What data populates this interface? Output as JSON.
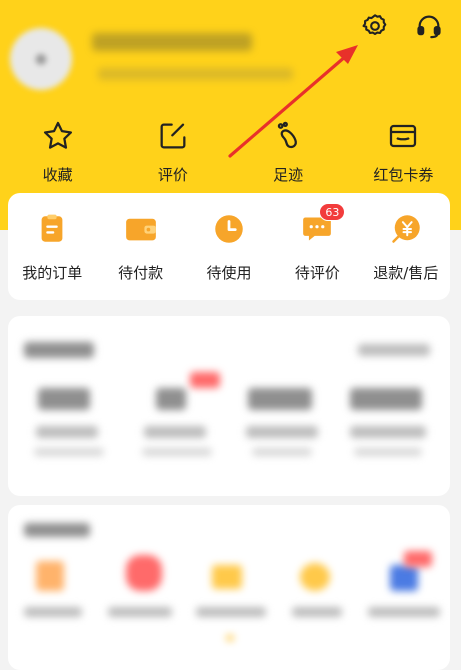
{
  "header": {
    "settings_icon": "gear-icon",
    "service_icon": "headset-icon"
  },
  "quick_links": [
    {
      "label": "收藏",
      "icon": "star-icon"
    },
    {
      "label": "评价",
      "icon": "edit-icon"
    },
    {
      "label": "足迹",
      "icon": "footprint-icon"
    },
    {
      "label": "红包卡券",
      "icon": "wallet-icon"
    }
  ],
  "orders": [
    {
      "label": "我的订单",
      "icon": "order-list-icon"
    },
    {
      "label": "待付款",
      "icon": "payment-wallet-icon"
    },
    {
      "label": "待使用",
      "icon": "clock-icon"
    },
    {
      "label": "待评价",
      "icon": "comment-icon",
      "badge": "63"
    },
    {
      "label": "退款/售后",
      "icon": "refund-yen-icon"
    }
  ],
  "colors": {
    "brand_yellow": "#ffd21a",
    "icon_orange": "#f7a52a",
    "badge_red": "#f23c3c",
    "arrow_red": "#e8312a"
  }
}
